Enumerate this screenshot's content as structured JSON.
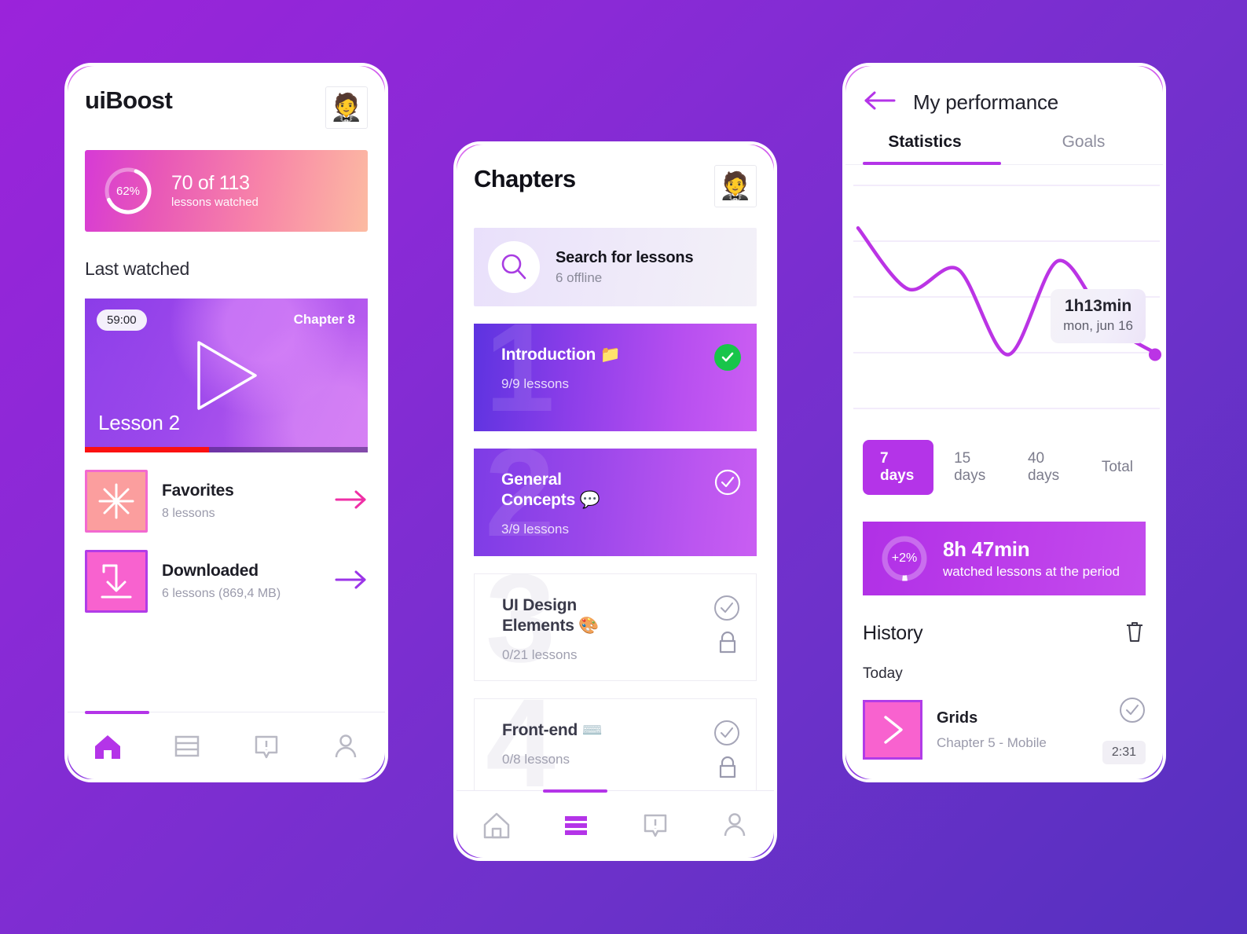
{
  "theme": {
    "bg_start": "#9b23da",
    "bg_end": "#5530bf",
    "accent_purple": "#b434e8",
    "accent_pink": "#f862cf",
    "green": "#18c54a",
    "red": "#fb1111"
  },
  "home": {
    "app_title": "uiBoost",
    "avatar_glyph": "🤵",
    "progress_card": {
      "percent_label": "62%",
      "percent_value": 62,
      "headline": "70 of 113",
      "sub": "lessons watched"
    },
    "section_title": "Last watched",
    "video": {
      "duration": "59:00",
      "chapter": "Chapter 8",
      "lesson": "Lesson 2",
      "progress_percent": 44,
      "play_icon": "play-icon"
    },
    "items": [
      {
        "title": "Favorites",
        "sub": "8 lessons",
        "icon": "asterisk-icon",
        "arrow": "arrow-right-icon"
      },
      {
        "title": "Downloaded",
        "sub": "6 lessons (869,4 MB)",
        "icon": "download-icon",
        "arrow": "arrow-right-icon"
      }
    ],
    "tabbar": {
      "active_index": 0,
      "tabs": [
        {
          "icon": "home-icon",
          "label": "Home"
        },
        {
          "icon": "list-icon",
          "label": "Chapters"
        },
        {
          "icon": "alert-bubble-icon",
          "label": "Notices"
        },
        {
          "icon": "person-icon",
          "label": "Profile"
        }
      ]
    }
  },
  "chapters": {
    "title": "Chapters",
    "avatar_glyph": "🤵",
    "search": {
      "title": "Search for lessons",
      "sub": "6 offline",
      "icon": "search-icon"
    },
    "cards": [
      {
        "num": "1",
        "name": "Introduction 📁",
        "sub": "9/9 lessons",
        "style": "gradient-blue",
        "mark": "check-filled-green",
        "locked": false
      },
      {
        "num": "2",
        "name": "General\nConcepts 💬",
        "sub": "3/9 lessons",
        "style": "gradient-purple",
        "mark": "check-outline-white",
        "locked": false
      },
      {
        "num": "3",
        "name": "UI Design\nElements 🎨",
        "sub": "0/21 lessons",
        "style": "plain",
        "mark": "check-outline-grey",
        "locked": true
      },
      {
        "num": "4",
        "name": "Front-end ⌨️",
        "sub": "0/8 lessons",
        "style": "plain",
        "mark": "check-outline-grey",
        "locked": true
      }
    ],
    "tabbar": {
      "active_index": 1,
      "tabs": [
        {
          "icon": "home-icon",
          "label": "Home"
        },
        {
          "icon": "list-icon",
          "label": "Chapters"
        },
        {
          "icon": "alert-bubble-icon",
          "label": "Notices"
        },
        {
          "icon": "person-icon",
          "label": "Profile"
        }
      ]
    }
  },
  "performance": {
    "back_icon": "arrow-left-icon",
    "title": "My performance",
    "tabs": [
      {
        "label": "Statistics",
        "active": true
      },
      {
        "label": "Goals",
        "active": false
      }
    ],
    "tooltip": {
      "value": "1h13min",
      "date": "mon, jun 16"
    },
    "periods": [
      {
        "label": "7 days",
        "active": true
      },
      {
        "label": "15 days",
        "active": false
      },
      {
        "label": "40 days",
        "active": false
      },
      {
        "label": "Total",
        "active": false
      }
    ],
    "watch_card": {
      "delta": "+2%",
      "delta_value": 2,
      "headline": "8h 47min",
      "sub": "watched lessons at the period"
    },
    "history": {
      "title": "History",
      "delete_icon": "trash-icon",
      "group_label": "Today",
      "rows": [
        {
          "name": "Grids",
          "sub": "Chapter 5 - Mobile",
          "time": "2:31",
          "mark": "check-outline-grey",
          "icon": "play-chevron-icon"
        }
      ]
    }
  },
  "chart_data": {
    "type": "line",
    "title": "",
    "xlabel": "",
    "ylabel": "",
    "grid": true,
    "gridlines_y": [
      0,
      1,
      2,
      3,
      4
    ],
    "legend": "none",
    "x": [
      0,
      1,
      2,
      3,
      4,
      5,
      6
    ],
    "y": [
      3.55,
      2.62,
      2.92,
      1.62,
      3.05,
      2.1,
      1.62
    ],
    "annotation": {
      "x": 6,
      "value_label": "1h13min",
      "date_label": "mon, jun 16"
    },
    "line_color": "#bb34e5",
    "point_color": "#bb34e5"
  }
}
